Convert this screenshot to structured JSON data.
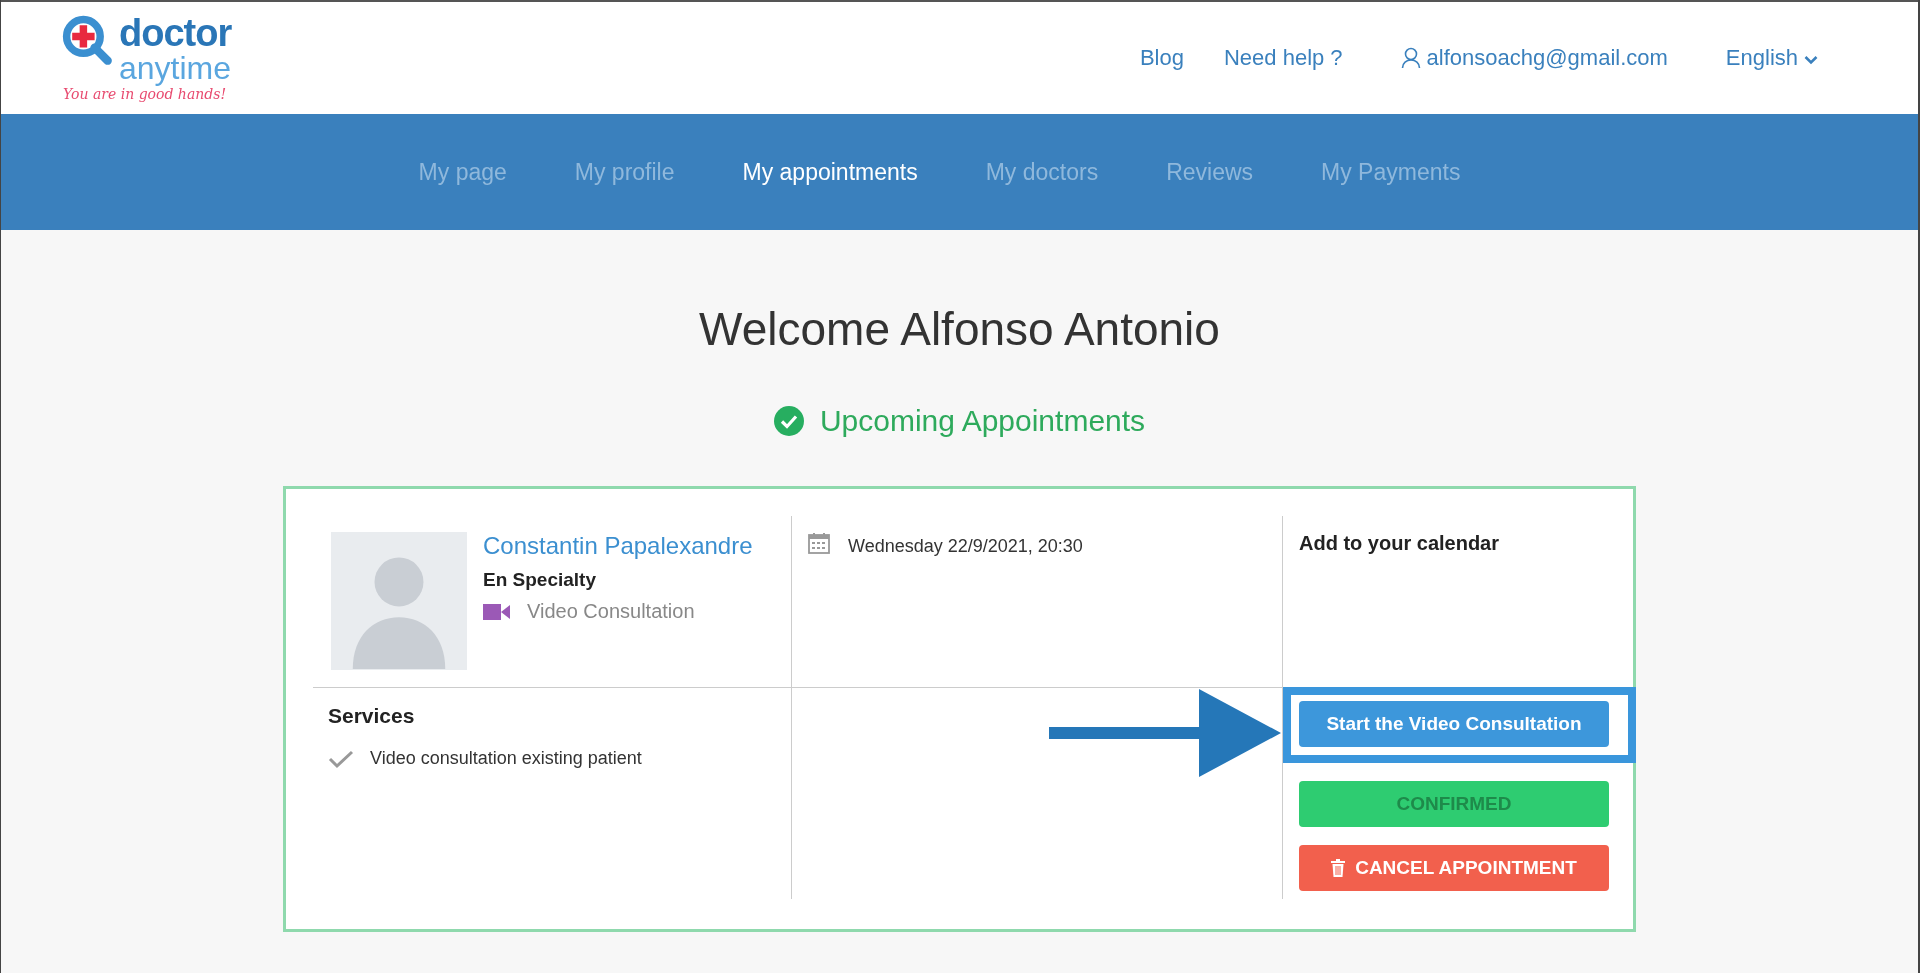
{
  "header": {
    "logo": {
      "word_1": "doctor",
      "word_2": "anytime",
      "tagline": "You are in good hands!"
    },
    "links": [
      "Blog",
      "Need help ?"
    ],
    "user": {
      "email": "alfonsoachg@gmail.com"
    },
    "language": {
      "value": "English"
    }
  },
  "nav": {
    "tabs": [
      {
        "label": "My page",
        "selected": false
      },
      {
        "label": "My profile",
        "selected": false
      },
      {
        "label": "My appointments",
        "selected": true
      },
      {
        "label": "My doctors",
        "selected": false
      },
      {
        "label": "Reviews",
        "selected": false
      },
      {
        "label": "My Payments",
        "selected": false
      }
    ]
  },
  "welcome": "Welcome Alfonso Antonio",
  "section_title": "Upcoming Appointments",
  "appointment": {
    "doctor": "Constantin Papalexandre",
    "specialty": "En Specialty",
    "consultation_type": "Video Consultation",
    "datetime": "Wednesday 22/9/2021, 20:30",
    "calendar_title": "Add to your calendar",
    "services_title": "Services",
    "services": [
      "Video consultation existing patient"
    ],
    "actions": [
      {
        "kind": "primary",
        "label": "Start the Video Consultation",
        "highlighted": true
      },
      {
        "kind": "status",
        "label": "CONFIRMED",
        "highlighted": false
      },
      {
        "kind": "danger",
        "label": "CANCEL APPOINTMENT",
        "highlighted": false
      }
    ]
  }
}
